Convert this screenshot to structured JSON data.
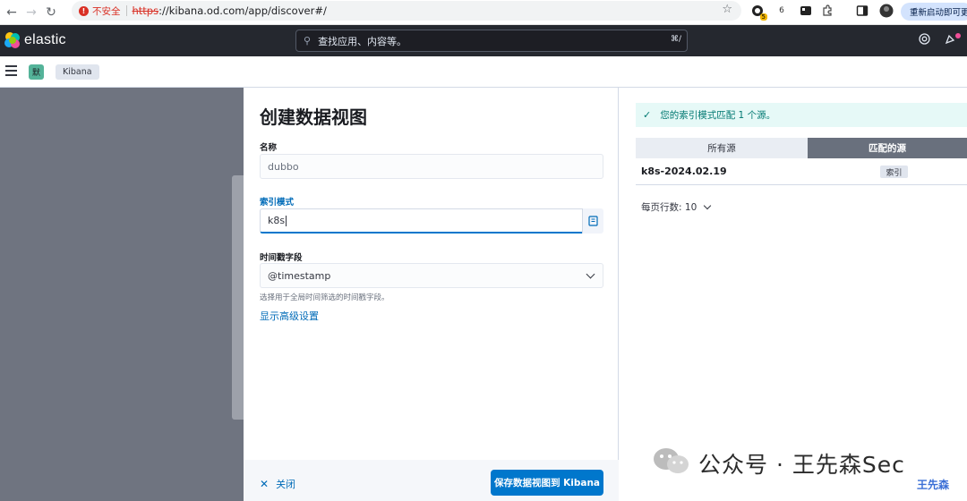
{
  "browser": {
    "security_label": "不安全",
    "url_scheme": "https",
    "url_rest": "://kibana.od.com/app/discover#/",
    "ext_badge": "5",
    "ext_6_label": "6",
    "restart_label": "重新启动即可更新"
  },
  "header": {
    "brand": "elastic",
    "search_placeholder": "查找应用、内容等。",
    "search_shortcut": "⌘/"
  },
  "subheader": {
    "space_initial": "默",
    "breadcrumb": "Kibana"
  },
  "form": {
    "title": "创建数据视图",
    "name_label": "名称",
    "name_value": "dubbo",
    "index_label": "索引模式",
    "index_value": "k8s",
    "timestamp_label": "时间戳字段",
    "timestamp_value": "@timestamp",
    "timestamp_help": "选择用于全局时间筛选的时间戳字段。",
    "advanced_link": "显示高级设置",
    "close_label": "关闭",
    "save_label": "保存数据视图到 Kibana"
  },
  "results": {
    "callout": "您的索引模式匹配 1 个源。",
    "tabs": [
      "所有源",
      "匹配的源"
    ],
    "active_tab": "匹配的源",
    "rows": [
      {
        "name": "k8s-2024.02.19",
        "badge": "索引"
      }
    ],
    "rows_per_page_label": "每页行数:",
    "rows_per_page": "10"
  },
  "watermark": {
    "text": "公众号 · 王先森Sec",
    "corner": "王先森"
  },
  "colors": {
    "primary": "#0077cc",
    "header_bg": "#25282f",
    "success_bg": "#e6f9f7",
    "success_text": "#007871"
  }
}
